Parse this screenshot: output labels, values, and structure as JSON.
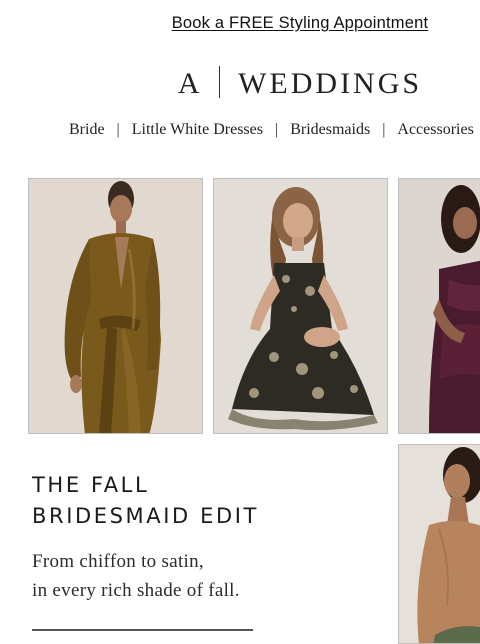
{
  "promo": {
    "link_text": "Book a FREE Styling Appointment"
  },
  "logo": {
    "mark": "A",
    "wordmark": "WEDDINGS"
  },
  "nav": {
    "items": [
      "Bride",
      "Little White Dresses",
      "Bridesmaids",
      "Accessories"
    ]
  },
  "hero": {
    "headline_line1": "THE FALL",
    "headline_line2": "BRIDESMAID EDIT",
    "subcopy_line1": "From chiffon to satin,",
    "subcopy_line2": "in every rich shade of fall."
  },
  "colors": {
    "bronze_satin": "#7a5a1c",
    "floral_dark": "#2e2a24",
    "burgundy_velvet": "#4a1a2e",
    "olive_green": "#5b6a4a",
    "photo_background": "#e2dcd6"
  }
}
